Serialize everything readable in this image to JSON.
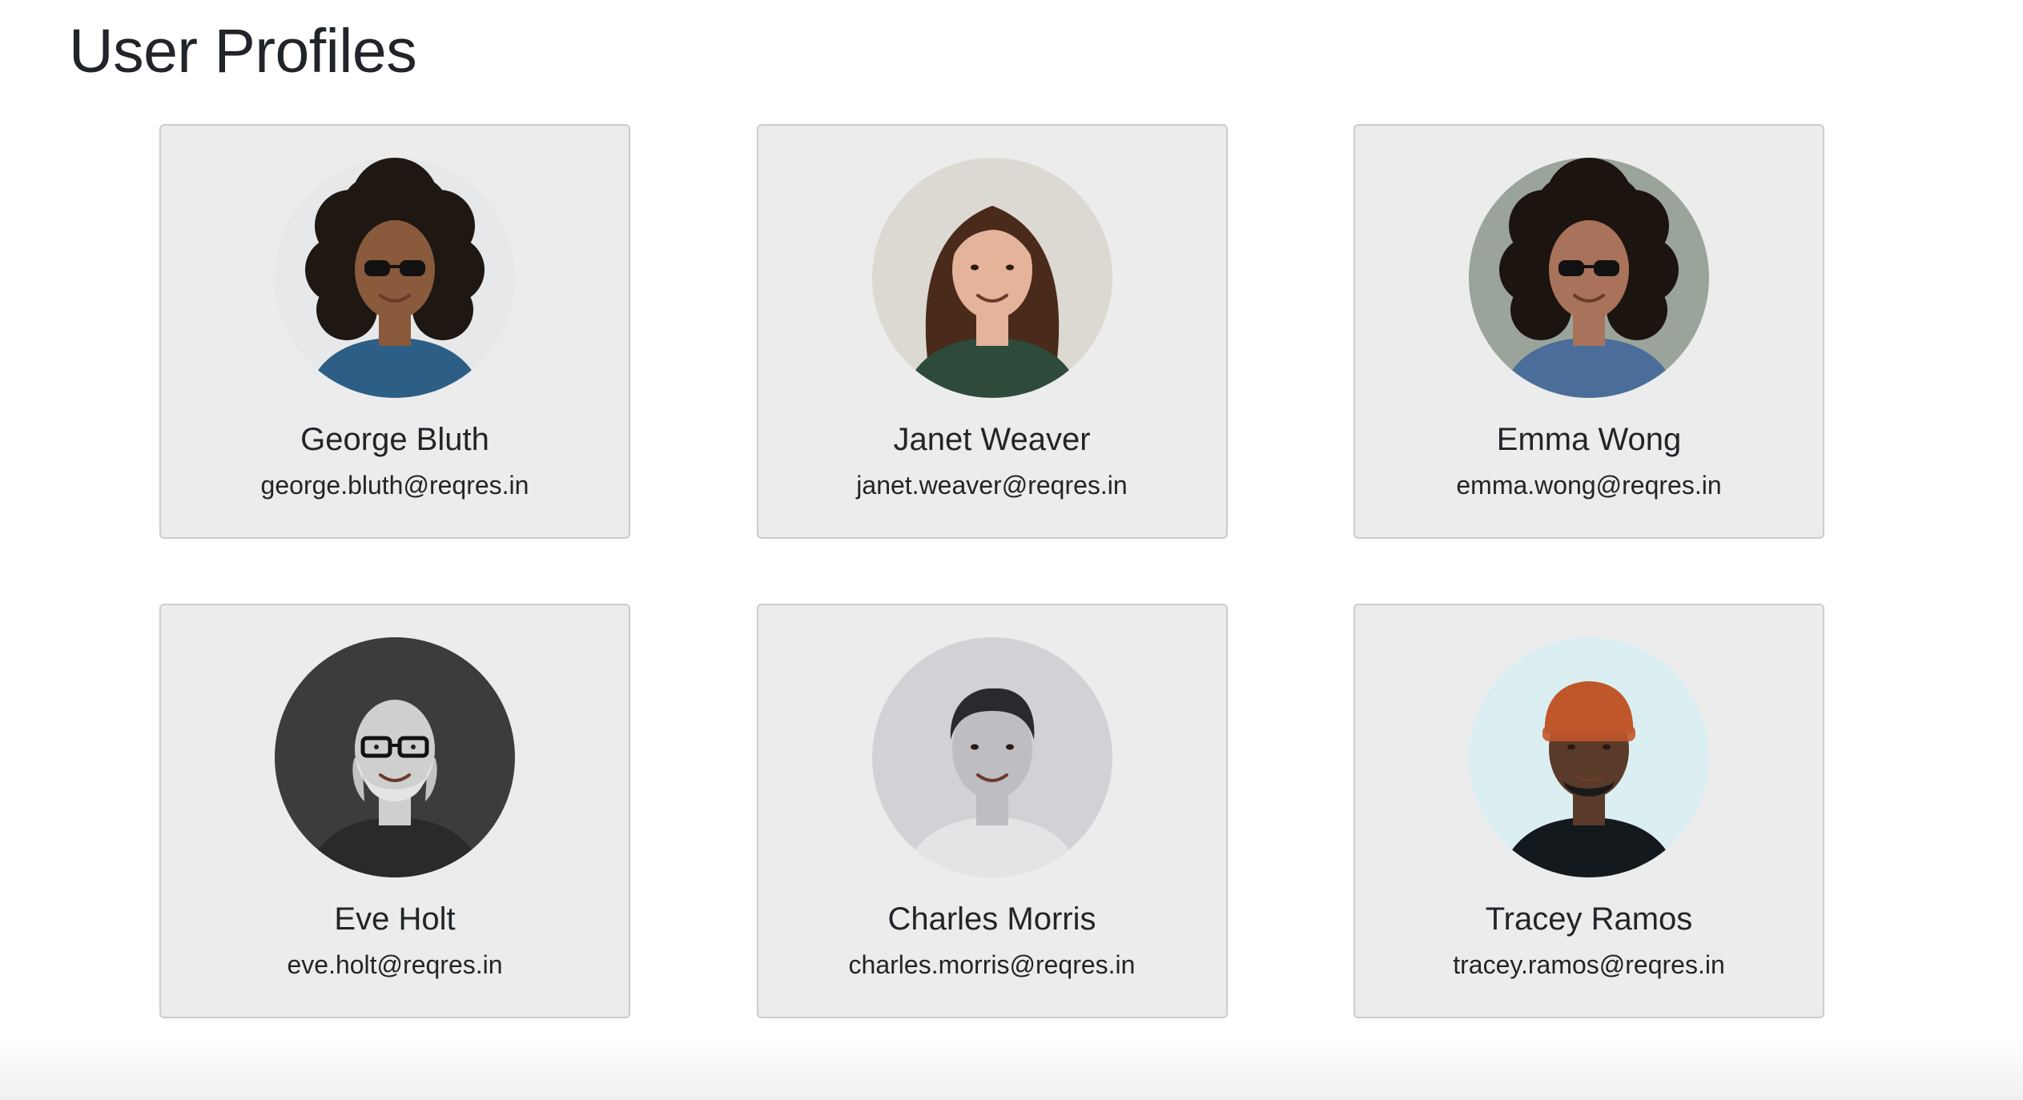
{
  "page": {
    "title": "User Profiles"
  },
  "users": [
    {
      "name": "George Bluth",
      "email": "george.bluth@reqres.in",
      "avatar": {
        "bg": "#e6e8ea",
        "skin": "#8a5a3c",
        "hair": "#1e1712",
        "shirt": "#2d5e85",
        "hair_style": "curly-big",
        "glasses": "sunglasses",
        "hat": ""
      }
    },
    {
      "name": "Janet Weaver",
      "email": "janet.weaver@reqres.in",
      "avatar": {
        "bg": "#dcd9d2",
        "skin": "#e5b39a",
        "hair": "#4a2a1a",
        "shirt": "#2e4a3a",
        "hair_style": "long-wavy",
        "glasses": "",
        "hat": ""
      }
    },
    {
      "name": "Emma Wong",
      "email": "emma.wong@reqres.in",
      "avatar": {
        "bg": "#9aa49a",
        "skin": "#a8735a",
        "hair": "#1c140f",
        "shirt": "#4a6e99",
        "hair_style": "curly-big",
        "glasses": "sunglasses",
        "hat": ""
      }
    },
    {
      "name": "Eve Holt",
      "email": "eve.holt@reqres.in",
      "avatar": {
        "bg": "#3c3c3c",
        "skin": "#cfcfcf",
        "hair": "#e4e4e4",
        "shirt": "#2a2a2a",
        "hair_style": "bald",
        "glasses": "glasses",
        "hat": ""
      }
    },
    {
      "name": "Charles Morris",
      "email": "charles.morris@reqres.in",
      "avatar": {
        "bg": "#d2d2d6",
        "skin": "#bdbdc2",
        "hair": "#2a2a2e",
        "shirt": "#e4e4e6",
        "hair_style": "short",
        "glasses": "",
        "hat": ""
      }
    },
    {
      "name": "Tracey Ramos",
      "email": "tracey.ramos@reqres.in",
      "avatar": {
        "bg": "#dbeff2",
        "skin": "#5a3a28",
        "hair": "#1a1a1a",
        "shirt": "#14191d",
        "hair_style": "beanie",
        "glasses": "",
        "hat": "#c0572b"
      }
    }
  ]
}
